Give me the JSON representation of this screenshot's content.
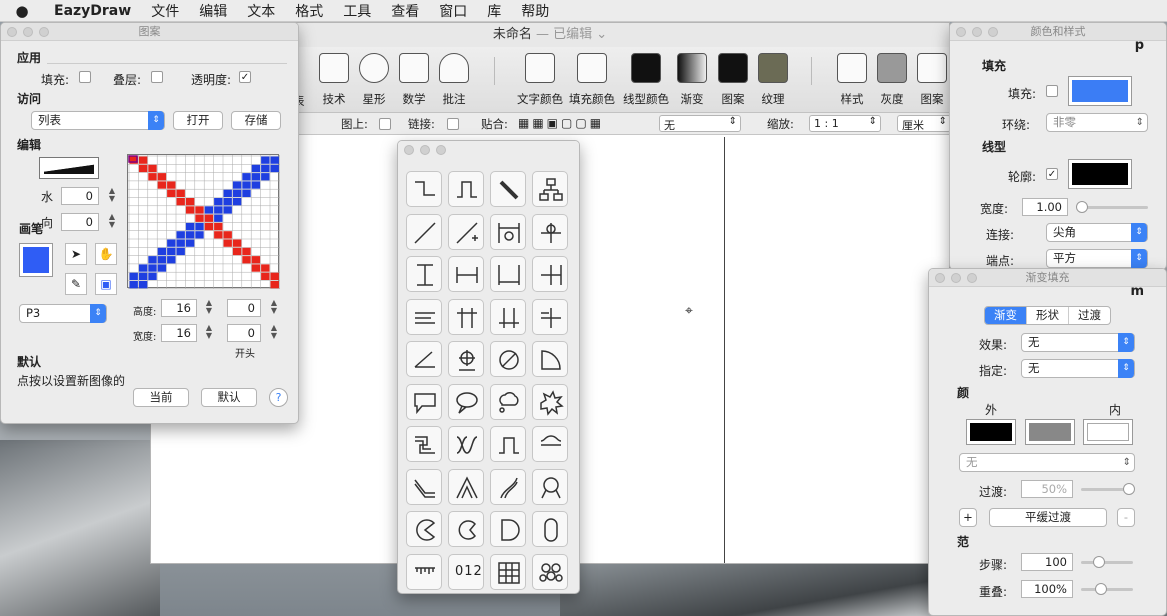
{
  "menubar": {
    "apple": "",
    "app": "EazyDraw",
    "items": [
      "文件",
      "编辑",
      "文本",
      "格式",
      "工具",
      "查看",
      "窗口",
      "库",
      "帮助"
    ]
  },
  "main": {
    "title": "未命名",
    "title_suffix": "— 已编辑",
    "toolbar": [
      "技术",
      "星形",
      "数学",
      "批注",
      "文字颜色",
      "填充颜色",
      "线型颜色",
      "渐变",
      "图案",
      "纹理",
      "样式",
      "灰度",
      "图案"
    ],
    "toolbar_cut": "表"
  },
  "optbar": {
    "on_image": "图上:",
    "link": "链接:",
    "snap": "贴合:",
    "snap_value": "无",
    "zoom": "缩放:",
    "zoom_value": "1 : 1",
    "unit": "厘米"
  },
  "pattern_panel": {
    "title": "图案",
    "apply": "应用",
    "fill": "填充:",
    "overlay": "叠层:",
    "transparency": "透明度:",
    "transparency_checked": "✓",
    "access": "访问",
    "list_value": "列表",
    "open": "打开",
    "save": "存储",
    "edit": "编辑",
    "water": "水",
    "water_val": "0",
    "dir": "向",
    "dir_val": "0",
    "pen": "画笔",
    "space": "P3",
    "height_label": "高度:",
    "height_val": "16",
    "height_val2": "0",
    "width_label": "宽度:",
    "width_val": "16",
    "width_val2": "0",
    "start": "开头",
    "default": "默认",
    "hint": "点按以设置新图像的",
    "current": "当前",
    "default_btn": "默认",
    "help": "?",
    "pen_color": "#2f5df5"
  },
  "color_panel": {
    "title": "颜色和样式",
    "fill_sec": "填充",
    "fill": "填充:",
    "fill_color": "#3b7df5",
    "winding": "环绕:",
    "winding_val": "非零",
    "line_sec": "线型",
    "stroke": "轮廓:",
    "stroke_checked": "✓",
    "stroke_color": "#000000",
    "width": "宽度:",
    "width_val": "1.00",
    "join": "连接:",
    "join_val": "尖角",
    "cap": "端点:",
    "cap_val": "平方",
    "tag": "p"
  },
  "gradient_panel": {
    "title": "渐变填充",
    "tabs": [
      "渐变",
      "形状",
      "过渡"
    ],
    "effect": "效果:",
    "effect_val": "无",
    "assign": "指定:",
    "assign_val": "无",
    "color_sec": "颜",
    "outer": "外",
    "inner": "内",
    "none_val": "无",
    "transition": "过渡:",
    "transition_val": "50%",
    "plus": "+",
    "smooth": "平缓过渡",
    "minus": "-",
    "range_sec": "范",
    "steps": "步骤:",
    "steps_val": "100",
    "repeat": "重叠:",
    "repeat_val": "100%",
    "tag": "m"
  },
  "shapes": {
    "labels": [
      "012"
    ]
  }
}
